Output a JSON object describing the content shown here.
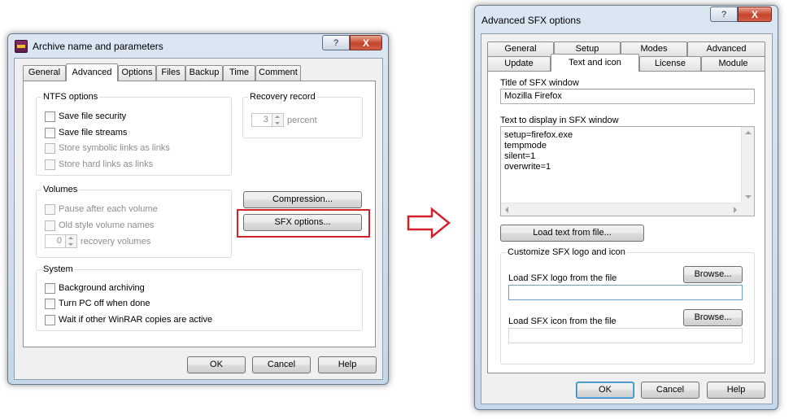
{
  "left_dialog": {
    "title": "Archive name and parameters",
    "tabs": [
      {
        "label": "General",
        "active": false
      },
      {
        "label": "Advanced",
        "active": true
      },
      {
        "label": "Options",
        "active": false
      },
      {
        "label": "Files",
        "active": false
      },
      {
        "label": "Backup",
        "active": false
      },
      {
        "label": "Time",
        "active": false
      },
      {
        "label": "Comment",
        "active": false
      }
    ],
    "ntfs": {
      "label": "NTFS options",
      "items": [
        {
          "label": "Save file security",
          "disabled": false
        },
        {
          "label": "Save file streams",
          "disabled": false
        },
        {
          "label": "Store symbolic links as links",
          "disabled": true
        },
        {
          "label": "Store hard links as links",
          "disabled": true
        }
      ]
    },
    "recovery": {
      "label": "Recovery record",
      "value": "3",
      "unit": "percent"
    },
    "volumes": {
      "label": "Volumes",
      "items": [
        {
          "label": "Pause after each volume",
          "disabled": true
        },
        {
          "label": "Old style volume names",
          "disabled": true
        }
      ],
      "recovery_value": "0",
      "recovery_label": "recovery volumes"
    },
    "compression_button": "Compression...",
    "sfx_button": "SFX options...",
    "system": {
      "label": "System",
      "items": [
        {
          "label": "Background archiving"
        },
        {
          "label": "Turn PC off when done"
        },
        {
          "label": "Wait if other WinRAR copies are active"
        }
      ]
    },
    "ok": "OK",
    "cancel": "Cancel",
    "help": "Help"
  },
  "right_dialog": {
    "title": "Advanced SFX options",
    "tabs_row1": [
      {
        "label": "General"
      },
      {
        "label": "Setup"
      },
      {
        "label": "Modes"
      },
      {
        "label": "Advanced"
      }
    ],
    "tabs_row2": [
      {
        "label": "Update",
        "active": false
      },
      {
        "label": "Text and icon",
        "active": true
      },
      {
        "label": "License",
        "active": false
      },
      {
        "label": "Module",
        "active": false
      }
    ],
    "title_label": "Title of SFX window",
    "title_value": "Mozilla Firefox",
    "text_label": "Text to display in SFX window",
    "text_lines": [
      "setup=firefox.exe",
      "tempmode",
      "silent=1",
      "overwrite=1"
    ],
    "load_text_button": "Load text from file...",
    "logo_group_label": "Customize SFX logo and icon",
    "logo_label": "Load SFX logo from the file",
    "icon_label": "Load SFX icon from the file",
    "browse": "Browse...",
    "logo_value": "",
    "icon_value": "",
    "ok": "OK",
    "cancel": "Cancel",
    "help": "Help"
  },
  "titlebar": {
    "help_glyph": "?",
    "close_glyph": "X"
  },
  "colors": {
    "highlight": "#d2232a",
    "arrow": "#d2232a"
  }
}
